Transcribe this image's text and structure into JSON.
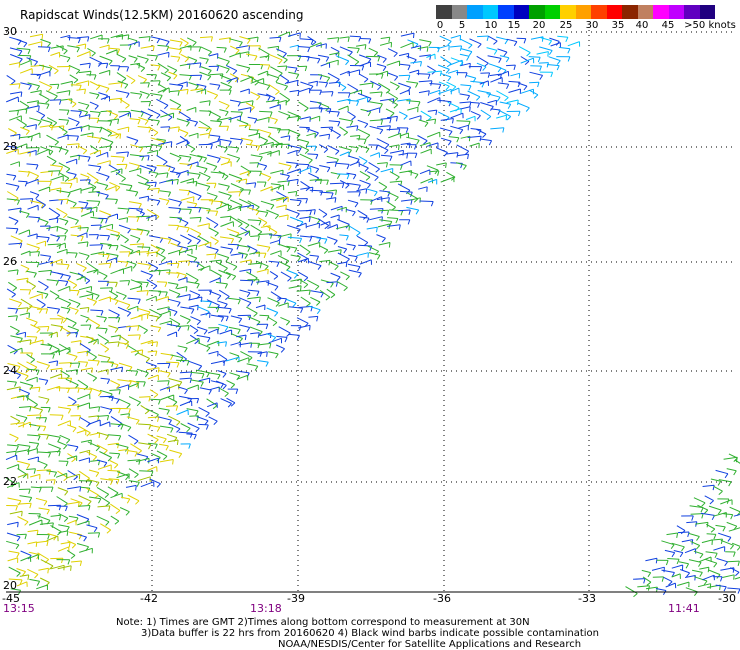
{
  "title": "Rapidscat Winds(12.5KM) 20160620 ascending",
  "legend": {
    "colors": [
      "#404040",
      "#888888",
      "#00a0ff",
      "#00c8ff",
      "#0040ff",
      "#0000c0",
      "#00a000",
      "#00d000",
      "#ffd000",
      "#ffa000",
      "#ff4000",
      "#ff0000",
      "#8b2500",
      "#c08060",
      "#ff00ff",
      "#c000ff",
      "#6000c0",
      "#200080"
    ],
    "labels": [
      "0",
      "5",
      "10",
      "15",
      "20",
      "25",
      "30",
      "35",
      "40",
      "45",
      ">50 knots"
    ]
  },
  "axes": {
    "x_ticks": [
      "-45",
      "-42",
      "-39",
      "-36",
      "-33",
      "-30"
    ],
    "y_ticks": [
      "30",
      "28",
      "26",
      "24",
      "22",
      "20"
    ]
  },
  "times": {
    "t1": "13:15",
    "t2": "13:18",
    "t3": "11:41"
  },
  "notes": {
    "line1": "Note: 1) Times are GMT 2)Times along bottom correspond to measurement at 30N",
    "line2": "3)Data buffer is 22 hrs from 20160620 4) Black wind barbs indicate possible contamination",
    "line3": "NOAA/NESDIS/Center for Satellite Applications and Research"
  }
}
